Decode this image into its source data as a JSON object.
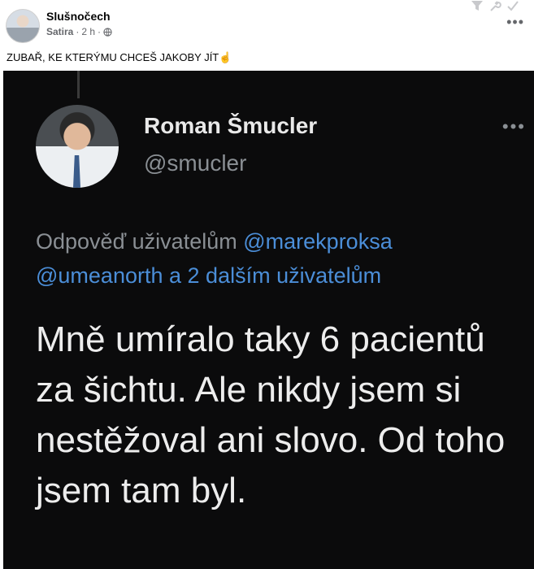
{
  "post": {
    "page_name": "Slušnočech",
    "category": "Satira",
    "time": "2 h",
    "separator": "·",
    "text": "ZUBAŘ, KE KTERÝMU CHCEŠ JAKOBY JÍT",
    "emoji": "☝"
  },
  "tweet": {
    "name": "Roman Šmucler",
    "handle": "@smucler",
    "more": "•••",
    "reply_prefix": "Odpověď uživatelům",
    "mention_1": "@marekproksa",
    "mention_2": "@umeanorth",
    "reply_suffix": "a 2 dalším uživatelům",
    "body": "Mně umíralo taky 6 pacientů za šichtu. Ale nikdy jsem si nestěžoval ani slovo. Od toho jsem tam byl."
  },
  "ui": {
    "more_label": "•••"
  }
}
